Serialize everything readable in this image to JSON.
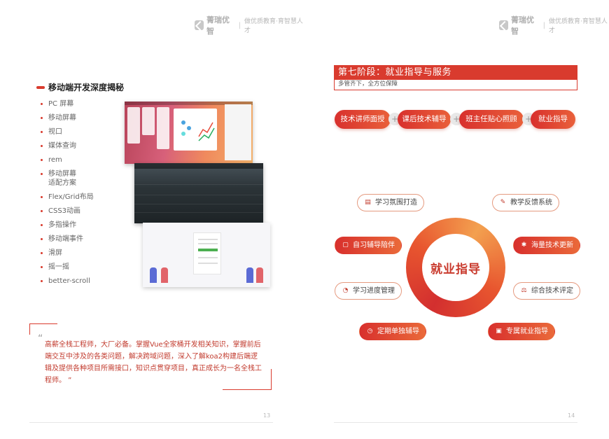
{
  "brand": {
    "name": "菁瑞优智",
    "slogan": "做优质教育·育智慧人才"
  },
  "left_page": {
    "section_title": "移动端开发深度揭秘",
    "topics": [
      "PC 屏幕",
      "移动屏幕",
      "视口",
      "媒体查询",
      "rem",
      "移动屏幕\n适配方案",
      "Flex/Grid布局",
      "CSS3动画",
      "多指操作",
      "移动端事件",
      "滑屏",
      "摇一摇",
      "better-scroll"
    ],
    "quote_open": "“",
    "quote": "高薪全栈工程师，大厂必备。掌握Vue全家桶开发相关知识，掌握前后端交互中涉及的各类问题，解决跨域问题，深入了解koa2构建后端逻辑及提供各种项目所需接口，知识点贯穿项目，真正成长为一名全栈工程师。 ”",
    "page_number": "13"
  },
  "right_page": {
    "stage_title": "第七阶段：就业指导与服务",
    "stage_subtitle": "多管齐下，全方位保障",
    "top_pills": [
      "技术讲师面授",
      "课后技术辅导",
      "班主任贴心照顾",
      "就业指导"
    ],
    "plus": "+",
    "center_label": "就业指导",
    "services": {
      "s1": {
        "label": "学习氛围打造",
        "icon": "book-icon"
      },
      "s2": {
        "label": "教学反馈系统",
        "icon": "edit-icon"
      },
      "s3": {
        "label": "自习辅导陪伴",
        "icon": "chat-icon"
      },
      "s4": {
        "label": "海量技术更新",
        "icon": "network-icon"
      },
      "s5": {
        "label": "学习进度管理",
        "icon": "progress-icon"
      },
      "s6": {
        "label": "综合技术评定",
        "icon": "evaluation-icon"
      },
      "s7": {
        "label": "定期单独辅导",
        "icon": "clock-icon"
      },
      "s8": {
        "label": "专属就业指导",
        "icon": "briefcase-icon"
      }
    },
    "accent_color": "#d93b2e",
    "page_number": "14"
  }
}
